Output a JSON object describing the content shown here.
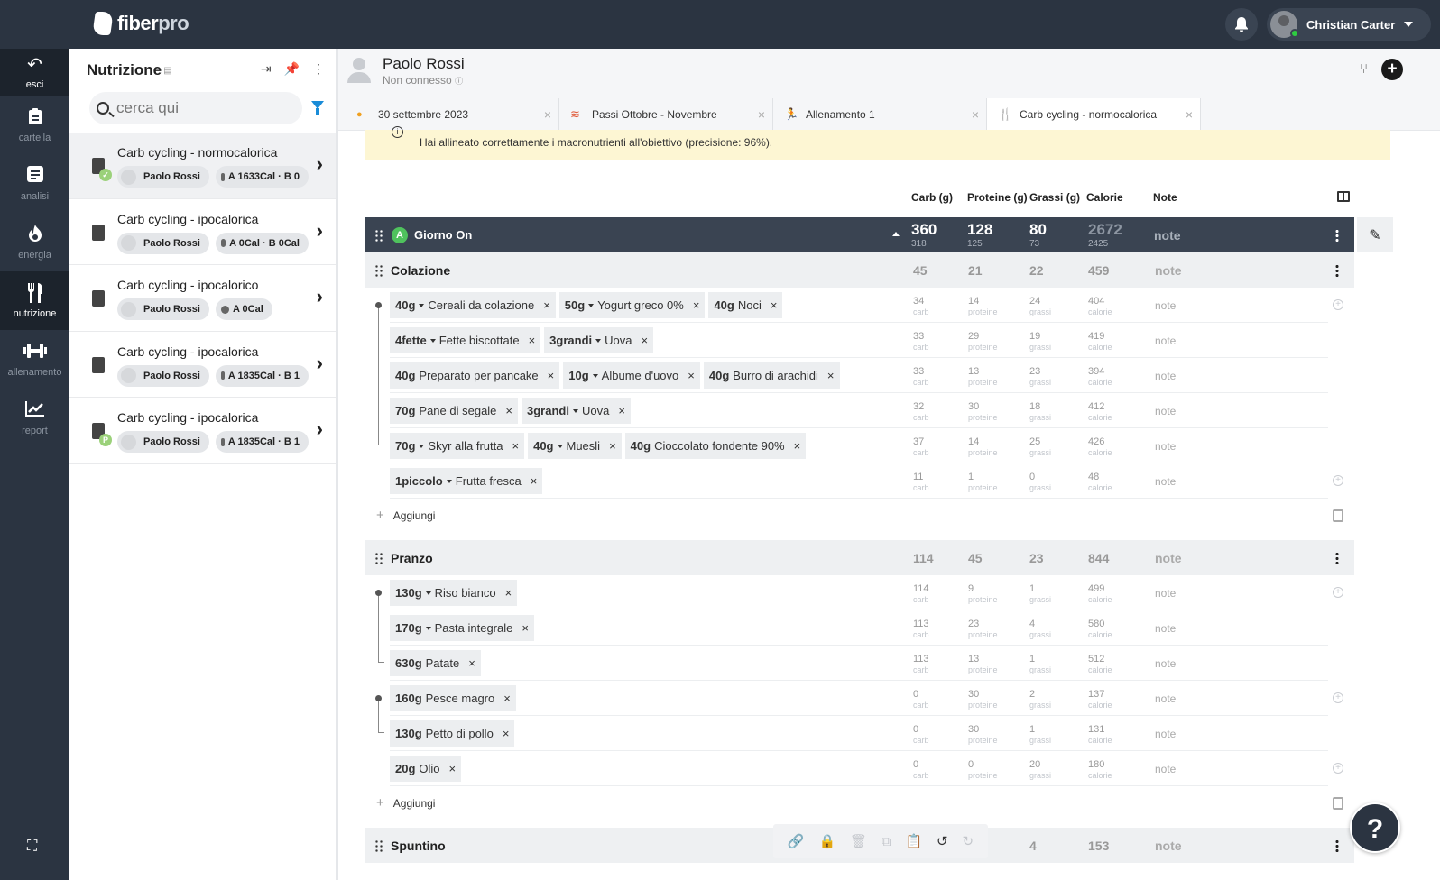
{
  "app": {
    "name_main": "fiber",
    "name_accent": "pro"
  },
  "user": {
    "name": "Christian Carter"
  },
  "nav": [
    {
      "label": "esci",
      "icon": "back-arrow-icon"
    },
    {
      "label": "cartella",
      "icon": "clipboard-icon"
    },
    {
      "label": "analisi",
      "icon": "document-icon"
    },
    {
      "label": "energia",
      "icon": "flame-icon"
    },
    {
      "label": "nutrizione",
      "icon": "fork-knife-icon"
    },
    {
      "label": "allenamento",
      "icon": "dumbbell-icon"
    },
    {
      "label": "report",
      "icon": "chart-line-icon"
    }
  ],
  "panel": {
    "title": "Nutrizione",
    "search_placeholder": "cerca qui",
    "items": [
      {
        "title": "Carb cycling - normocalorica",
        "client": "Paolo Rossi",
        "summary": "A 1633Cal · B 0"
      },
      {
        "title": "Carb cycling - ipocalorica",
        "client": "Paolo Rossi",
        "summary": "A 0Cal · B 0Cal"
      },
      {
        "title": "Carb cycling - ipocalorico",
        "client": "Paolo Rossi",
        "summary": "A 0Cal"
      },
      {
        "title": "Carb cycling - ipocalorica",
        "client": "Paolo Rossi",
        "summary": "A 1835Cal · B 1"
      },
      {
        "title": "Carb cycling - ipocalorica",
        "client": "Paolo Rossi",
        "summary": "A 1835Cal · B 1"
      }
    ]
  },
  "header": {
    "name": "Paolo Rossi",
    "status": "Non connesso"
  },
  "tabs": [
    {
      "label": "30 settembre 2023",
      "icon": "flame-icon"
    },
    {
      "label": "Passi Ottobre - Novembre",
      "icon": "shoe-icon"
    },
    {
      "label": "Allenamento 1",
      "icon": "runner-icon"
    },
    {
      "label": "Carb cycling - normocalorica",
      "icon": "fork-knife-icon"
    }
  ],
  "alert": "Hai allineato correttamente i macronutrienti all'obiettivo (precisione: 96%).",
  "columns": {
    "carb": "Carb (g)",
    "prot": "Proteine (g)",
    "fat": "Grassi (g)",
    "cal": "Calorie",
    "note": "Note"
  },
  "day": {
    "badge": "A",
    "name": "Giorno On",
    "carb": "360",
    "carb_target": "318",
    "prot": "128",
    "prot_target": "125",
    "fat": "80",
    "fat_target": "73",
    "cal": "2672",
    "cal_target": "2425",
    "note": "note"
  },
  "units": {
    "carb": "carb",
    "prot": "proteine",
    "fat": "grassi",
    "cal": "calorie"
  },
  "note_label": "note",
  "add_label": "Aggiungi",
  "sections": [
    {
      "name": "Colazione",
      "carb": "45",
      "prot": "21",
      "fat": "22",
      "cal": "459",
      "note": "note",
      "rows": [
        {
          "foods": [
            {
              "q": "40g",
              "dd": true,
              "n": "Cereali da colazione"
            },
            {
              "q": "50g",
              "dd": true,
              "n": "Yogurt greco 0%"
            },
            {
              "q": "40g",
              "dd": false,
              "n": "Noci"
            }
          ],
          "carb": "34",
          "prot": "14",
          "fat": "24",
          "cal": "404"
        },
        {
          "foods": [
            {
              "q": "4fette",
              "dd": true,
              "n": "Fette biscottate"
            },
            {
              "q": "3grandi",
              "dd": true,
              "n": "Uova"
            }
          ],
          "carb": "33",
          "prot": "29",
          "fat": "19",
          "cal": "419"
        },
        {
          "foods": [
            {
              "q": "40g",
              "dd": false,
              "n": "Preparato per pancake"
            },
            {
              "q": "10g",
              "dd": true,
              "n": "Albume d'uovo"
            },
            {
              "q": "40g",
              "dd": false,
              "n": "Burro di arachidi"
            }
          ],
          "carb": "33",
          "prot": "13",
          "fat": "23",
          "cal": "394"
        },
        {
          "foods": [
            {
              "q": "70g",
              "dd": false,
              "n": "Pane di segale"
            },
            {
              "q": "3grandi",
              "dd": true,
              "n": "Uova"
            }
          ],
          "carb": "32",
          "prot": "30",
          "fat": "18",
          "cal": "412"
        },
        {
          "foods": [
            {
              "q": "70g",
              "dd": true,
              "n": "Skyr alla frutta"
            },
            {
              "q": "40g",
              "dd": true,
              "n": "Muesli"
            },
            {
              "q": "40g",
              "dd": false,
              "n": "Cioccolato fondente 90%"
            }
          ],
          "carb": "37",
          "prot": "14",
          "fat": "25",
          "cal": "426"
        },
        {
          "foods": [
            {
              "q": "1piccolo",
              "dd": true,
              "n": "Frutta fresca"
            }
          ],
          "carb": "11",
          "prot": "1",
          "fat": "0",
          "cal": "48"
        }
      ]
    },
    {
      "name": "Pranzo",
      "carb": "114",
      "prot": "45",
      "fat": "23",
      "cal": "844",
      "note": "note",
      "rows": [
        {
          "foods": [
            {
              "q": "130g",
              "dd": true,
              "n": "Riso bianco"
            }
          ],
          "carb": "114",
          "prot": "9",
          "fat": "1",
          "cal": "499"
        },
        {
          "foods": [
            {
              "q": "170g",
              "dd": true,
              "n": "Pasta integrale"
            }
          ],
          "carb": "113",
          "prot": "23",
          "fat": "4",
          "cal": "580"
        },
        {
          "foods": [
            {
              "q": "630g",
              "dd": false,
              "n": "Patate"
            }
          ],
          "carb": "113",
          "prot": "13",
          "fat": "1",
          "cal": "512"
        },
        {
          "foods": [
            {
              "q": "160g",
              "dd": false,
              "n": "Pesce magro"
            }
          ],
          "carb": "0",
          "prot": "30",
          "fat": "2",
          "cal": "137"
        },
        {
          "foods": [
            {
              "q": "130g",
              "dd": false,
              "n": "Petto di pollo"
            }
          ],
          "carb": "0",
          "prot": "30",
          "fat": "1",
          "cal": "131"
        },
        {
          "foods": [
            {
              "q": "20g",
              "dd": false,
              "n": "Olio"
            }
          ],
          "carb": "0",
          "prot": "0",
          "fat": "20",
          "cal": "180"
        }
      ]
    },
    {
      "name": "Spuntino",
      "fat": "4",
      "cal": "153",
      "note": "note"
    }
  ],
  "toolbar": [
    "link-icon",
    "lock-icon",
    "trash-icon",
    "copy-icon",
    "paste-icon",
    "undo-icon",
    "redo-icon"
  ],
  "help": "?"
}
